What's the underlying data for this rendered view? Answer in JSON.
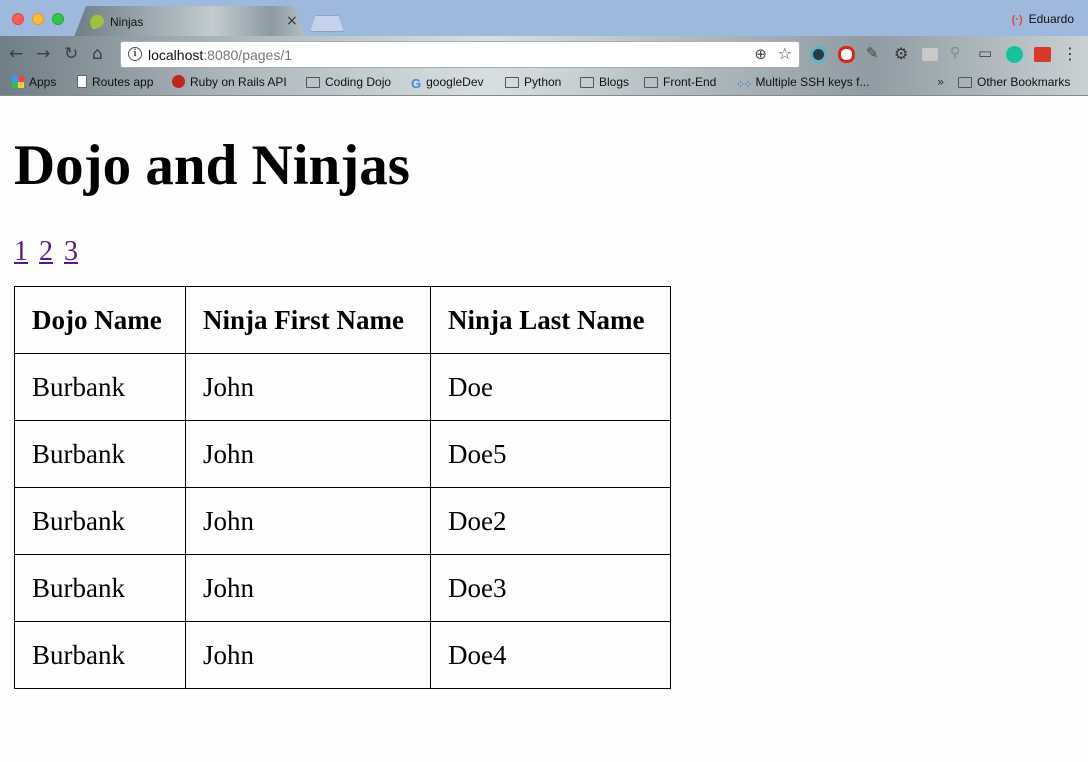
{
  "browser": {
    "tab_title": "Ninjas",
    "tab_close": "×",
    "profile_name": "Eduardo",
    "profile_icon": "(·)",
    "url_host": "localhost",
    "url_rest": ":8080/pages/1",
    "nav": {
      "back": "←",
      "forward": "→",
      "reload": "↻",
      "home": "⌂"
    },
    "zoom_icon": "⊕",
    "star_icon": "☆",
    "menu_icon": "⋮",
    "bookmarks": [
      {
        "label": "Apps"
      },
      {
        "label": "Routes app"
      },
      {
        "label": "Ruby on Rails API"
      },
      {
        "label": "Coding Dojo"
      },
      {
        "label": "googleDev"
      },
      {
        "label": "Python"
      },
      {
        "label": "Blogs"
      },
      {
        "label": "Front-End"
      },
      {
        "label": "Multiple SSH keys f..."
      },
      {
        "label": "Other Bookmarks"
      }
    ],
    "bookmarks_overflow": "»"
  },
  "page": {
    "title": "Dojo and Ninjas",
    "pages": [
      "1",
      "2",
      "3"
    ],
    "table": {
      "headers": [
        "Dojo Name",
        "Ninja First Name",
        "Ninja Last Name"
      ],
      "rows": [
        [
          "Burbank",
          "John",
          "Doe"
        ],
        [
          "Burbank",
          "John",
          "Doe5"
        ],
        [
          "Burbank",
          "John",
          "Doe2"
        ],
        [
          "Burbank",
          "John",
          "Doe3"
        ],
        [
          "Burbank",
          "John",
          "Doe4"
        ]
      ]
    }
  }
}
